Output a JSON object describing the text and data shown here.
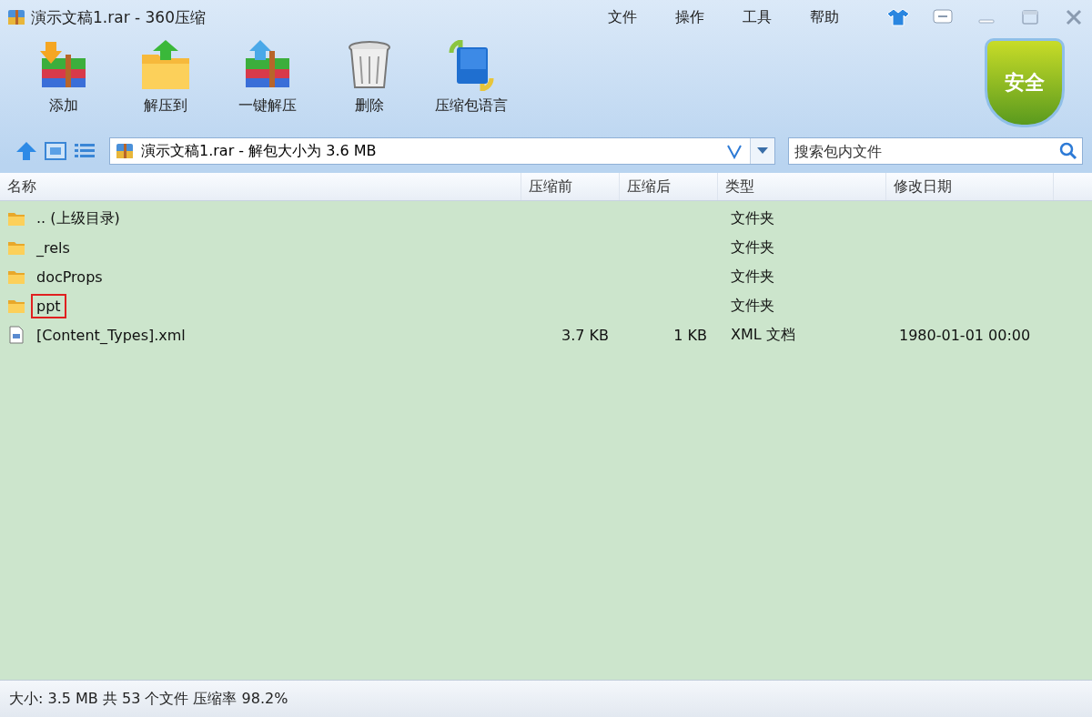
{
  "window": {
    "title": "演示文稿1.rar - 360压缩"
  },
  "menu": [
    "文件",
    "操作",
    "工具",
    "帮助"
  ],
  "toolbar": [
    {
      "label": "添加",
      "kind": "add"
    },
    {
      "label": "解压到",
      "kind": "extract"
    },
    {
      "label": "一键解压",
      "kind": "quick"
    },
    {
      "label": "删除",
      "kind": "delete"
    },
    {
      "label": "压缩包语言",
      "kind": "encoding"
    }
  ],
  "security_badge": "安全",
  "address": {
    "value": "演示文稿1.rar - 解包大小为 3.6 MB"
  },
  "search": {
    "placeholder": "搜索包内文件"
  },
  "table": {
    "columns": [
      "名称",
      "压缩前",
      "压缩后",
      "类型",
      "修改日期"
    ],
    "rows": [
      {
        "name": ".. (上级目录)",
        "kind": "folder",
        "size": "",
        "packed": "",
        "type": "文件夹",
        "date": "",
        "marked": false
      },
      {
        "name": "_rels",
        "kind": "folder",
        "size": "",
        "packed": "",
        "type": "文件夹",
        "date": "",
        "marked": false
      },
      {
        "name": "docProps",
        "kind": "folder",
        "size": "",
        "packed": "",
        "type": "文件夹",
        "date": "",
        "marked": false
      },
      {
        "name": "ppt",
        "kind": "folder",
        "size": "",
        "packed": "",
        "type": "文件夹",
        "date": "",
        "marked": true
      },
      {
        "name": "[Content_Types].xml",
        "kind": "file",
        "size": "3.7 KB",
        "packed": "1 KB",
        "type": "XML 文档",
        "date": "1980-01-01 00:00",
        "marked": false
      }
    ]
  },
  "status_bar": "大小: 3.5 MB 共 53 个文件 压缩率 98.2%"
}
